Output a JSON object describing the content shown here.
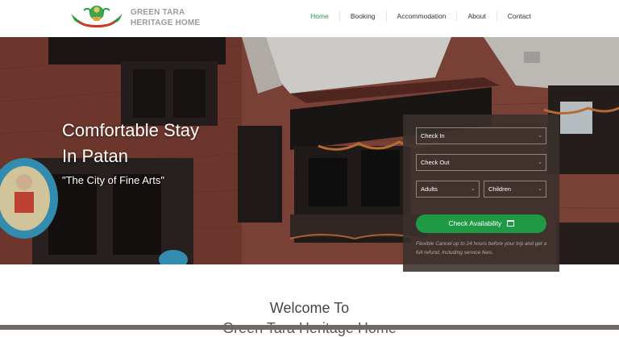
{
  "brand": {
    "line1": "GREEN TARA",
    "line2": "HERITAGE HOME"
  },
  "nav": {
    "items": [
      {
        "label": "Home",
        "active": true
      },
      {
        "label": "Booking"
      },
      {
        "label": "Accommodation"
      },
      {
        "label": "About"
      },
      {
        "label": "Contact"
      }
    ]
  },
  "hero": {
    "title_line1": "Comfortable Stay",
    "title_line2": "In Patan",
    "subtitle": "\"The City of Fine Arts\""
  },
  "booking": {
    "check_in": "Check In",
    "check_out": "Check Out",
    "adults": "Adults",
    "children": "Children",
    "button": "Check Availability",
    "note": "Flexible Cancel up to 24 hours before your trip and get a full refund, including service fees."
  },
  "welcome": {
    "line1": "Welcome To",
    "line2": "Green Tara Heritage Home"
  },
  "colors": {
    "accent": "#1f9a44",
    "brand_text": "#9a9a9a",
    "panel": "#3a302e"
  },
  "icons": {
    "calendar": "calendar-icon",
    "chevron": "chevron-down-icon"
  }
}
